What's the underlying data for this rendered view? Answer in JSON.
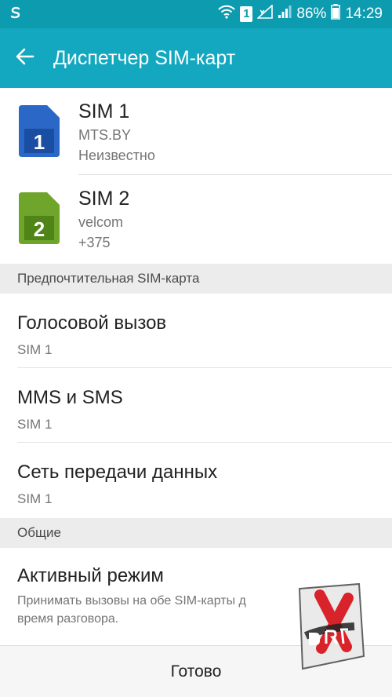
{
  "status_bar": {
    "sim_indicator": "1",
    "battery": "86%",
    "time": "14:29"
  },
  "app_bar": {
    "title": "Диспетчер SIM-карт",
    "back_icon": "arrow-left-icon"
  },
  "sims": [
    {
      "badge": "1",
      "name": "SIM 1",
      "operator": "MTS.BY",
      "number": "Неизвестно",
      "color": "#2b67c6"
    },
    {
      "badge": "2",
      "name": "SIM 2",
      "operator": "velcom",
      "number": "+375",
      "color": "#6fa52a"
    }
  ],
  "sections": {
    "preferred": "Предпочтительная SIM-карта",
    "general": "Общие"
  },
  "preferred_settings": [
    {
      "title": "Голосовой вызов",
      "value": "SIM 1"
    },
    {
      "title": "MMS и SMS",
      "value": "SIM 1"
    },
    {
      "title": "Сеть передачи данных",
      "value": "SIM 1"
    }
  ],
  "general_settings": {
    "active_mode": {
      "title": "Активный режим",
      "description_line1": "Принимать вызовы на обе SIM-карты д",
      "description_line2": "время разговора."
    }
  },
  "bottom_bar": {
    "done_label": "Готово"
  },
  "colors": {
    "status_bar": "#0d9bb0",
    "app_bar": "#13a8bf",
    "sim1": "#2b67c6",
    "sim2": "#6fa52a"
  }
}
